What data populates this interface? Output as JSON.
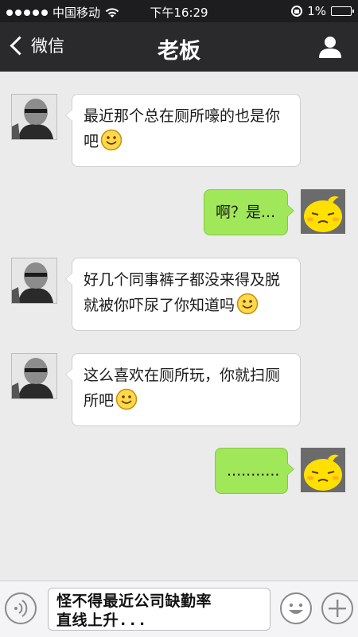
{
  "status_bar": {
    "carrier": "中国移动",
    "time": "下午16:29",
    "battery": "1%"
  },
  "navbar": {
    "back_label": "微信",
    "title": "老板",
    "profile_icon": "person-icon"
  },
  "messages": [
    {
      "from": "boss",
      "lines": [
        "最近那个总在厕所嚎的也是你",
        "吧"
      ],
      "emoji": "smile-emoji"
    },
    {
      "from": "me",
      "text": "啊？是..."
    },
    {
      "from": "boss",
      "lines": [
        "好几个同事裤子都没来得及脱",
        "就被你吓尿了你知道吗"
      ],
      "emoji": "smile-emoji"
    },
    {
      "from": "boss",
      "lines": [
        "这么喜欢在厕所玩，你就扫厕",
        "所吧"
      ],
      "emoji": "smile-emoji"
    },
    {
      "from": "me",
      "text": "..........."
    }
  ],
  "input_bar": {
    "text_line1": "怪不得最近公司缺勤率",
    "text_line2": "直线上升..."
  },
  "colors": {
    "status_bg": "#1d1d1f",
    "nav_bg": "#2a2a2d",
    "chat_bg": "#ebebeb",
    "my_bubble": "#a0e759",
    "their_bubble": "#ffffff"
  }
}
